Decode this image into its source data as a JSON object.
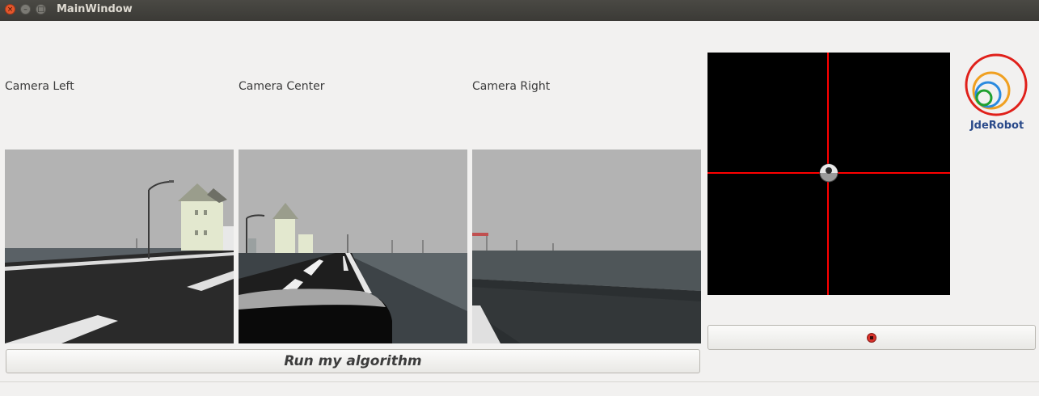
{
  "window": {
    "title": "MainWindow",
    "close_glyph": "×",
    "minimize_glyph": "–",
    "maximize_glyph": "□"
  },
  "cameras": {
    "left_label": "Camera Left",
    "center_label": "Camera Center",
    "right_label": "Camera Right"
  },
  "controls": {
    "run_label": "Run my algorithm",
    "stop_icon": "record-stop-icon",
    "stop_color": "#d9322b"
  },
  "teleop": {
    "crosshair_color": "#ff0000",
    "handle_icon": "joystick-ball-icon"
  },
  "logo": {
    "text": "JdeRobot",
    "colors": [
      "#e0201a",
      "#f0a020",
      "#2a8adf",
      "#20a030"
    ]
  }
}
